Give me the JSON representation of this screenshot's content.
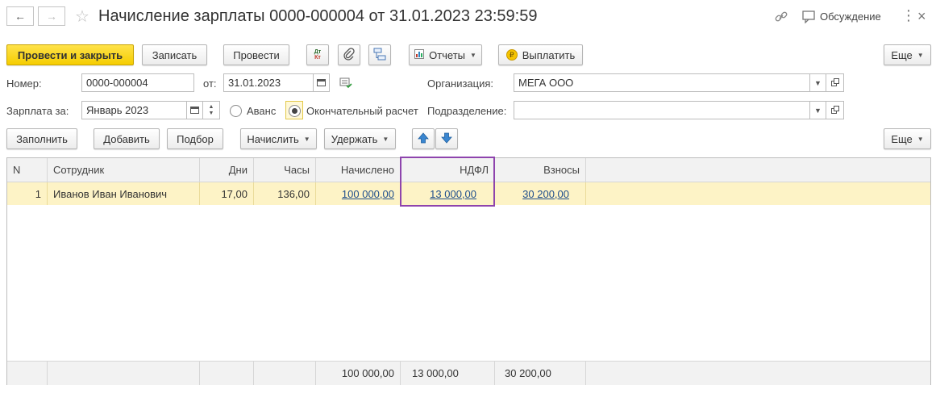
{
  "window": {
    "title": "Начисление зарплаты 0000-000004 от 31.01.2023 23:59:59",
    "discuss_label": "Обсуждение"
  },
  "toolbar": {
    "post_close": "Провести и закрыть",
    "save": "Записать",
    "post": "Провести",
    "dtkt_top": "Дт",
    "dtkt_bottom": "Кт",
    "reports": "Отчеты",
    "pay": "Выплатить",
    "more": "Еще"
  },
  "form": {
    "number_label": "Номер:",
    "number_value": "0000-000004",
    "date_label": "от:",
    "date_value": "31.01.2023",
    "org_label": "Организация:",
    "org_value": "МЕГА ООО",
    "salary_for_label": "Зарплата за:",
    "salary_for_value": "Январь 2023",
    "radio_advance": "Аванс",
    "radio_final": "Окончательный расчет",
    "radio_selected": "final",
    "dept_label": "Подразделение:",
    "dept_value": ""
  },
  "table_toolbar": {
    "fill": "Заполнить",
    "add": "Добавить",
    "select": "Подбор",
    "accrue": "Начислить",
    "withhold": "Удержать",
    "more": "Еще"
  },
  "table": {
    "headers": [
      "N",
      "Сотрудник",
      "Дни",
      "Часы",
      "Начислено",
      "НДФЛ",
      "Взносы"
    ],
    "rows": [
      {
        "n": "1",
        "employee": "Иванов Иван Иванович",
        "days": "17,00",
        "hours": "136,00",
        "accrued": "100 000,00",
        "ndfl": "13 000,00",
        "contributions": "30 200,00"
      }
    ],
    "totals": {
      "accrued": "100 000,00",
      "ndfl": "13 000,00",
      "contributions": "30 200,00"
    }
  },
  "colors": {
    "primary_button": "#f5cd00",
    "selected_row": "#fdf3c6",
    "highlight_box": "#8e44ad",
    "link": "#1f4e8c"
  }
}
